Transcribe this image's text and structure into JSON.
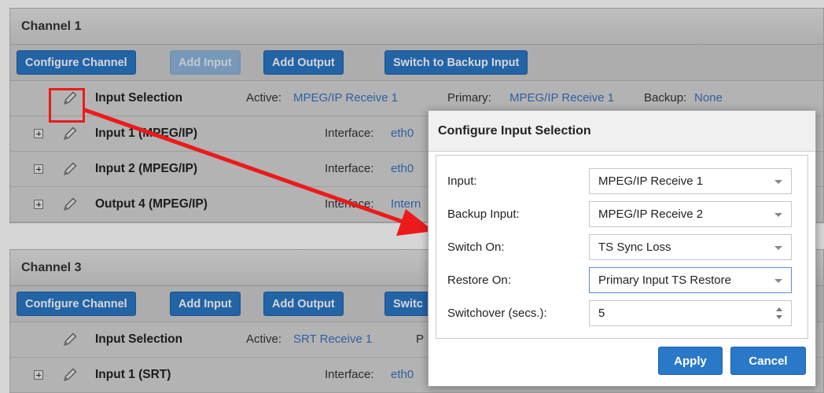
{
  "channel1": {
    "title": "Channel 1",
    "buttons": {
      "configure": "Configure Channel",
      "add_input": "Add Input",
      "add_output": "Add Output",
      "switch_backup": "Switch to Backup Input"
    },
    "input_selection": {
      "label": "Input Selection",
      "active_key": "Active:",
      "active_val": "MPEG/IP Receive 1",
      "primary_key": "Primary:",
      "primary_val": "MPEG/IP Receive 1",
      "backup_key": "Backup:",
      "backup_val": "None"
    },
    "rows": [
      {
        "name": "Input 1 (MPEG/IP)",
        "key": "Interface:",
        "val": "eth0"
      },
      {
        "name": "Input 2 (MPEG/IP)",
        "key": "Interface:",
        "val": "eth0"
      },
      {
        "name": "Output 4 (MPEG/IP)",
        "key": "Interface:",
        "val": "Intern"
      }
    ]
  },
  "channel3": {
    "title": "Channel 3",
    "buttons": {
      "configure": "Configure Channel",
      "add_input": "Add Input",
      "add_output": "Add Output",
      "switch_partial": "Switc"
    },
    "input_selection": {
      "label": "Input Selection",
      "active_key": "Active:",
      "active_val": "SRT Receive 1",
      "primary_partial": "P"
    },
    "rows": [
      {
        "name": "Input 1 (SRT)",
        "key": "Interface:",
        "val": "eth0"
      }
    ]
  },
  "dialog": {
    "title": "Configure Input Selection",
    "fields": [
      {
        "label": "Input:",
        "value": "MPEG/IP Receive 1",
        "kind": "select"
      },
      {
        "label": "Backup Input:",
        "value": "MPEG/IP Receive 2",
        "kind": "select"
      },
      {
        "label": "Switch On:",
        "value": "TS Sync Loss",
        "kind": "select"
      },
      {
        "label": "Restore On:",
        "value": "Primary Input TS Restore",
        "kind": "select"
      },
      {
        "label": "Switchover (secs.):",
        "value": "5",
        "kind": "spinner"
      }
    ],
    "apply": "Apply",
    "cancel": "Cancel"
  },
  "colors": {
    "accent": "#2a78c8",
    "link": "#3a72c4",
    "annotation": "#ec1a1a"
  }
}
